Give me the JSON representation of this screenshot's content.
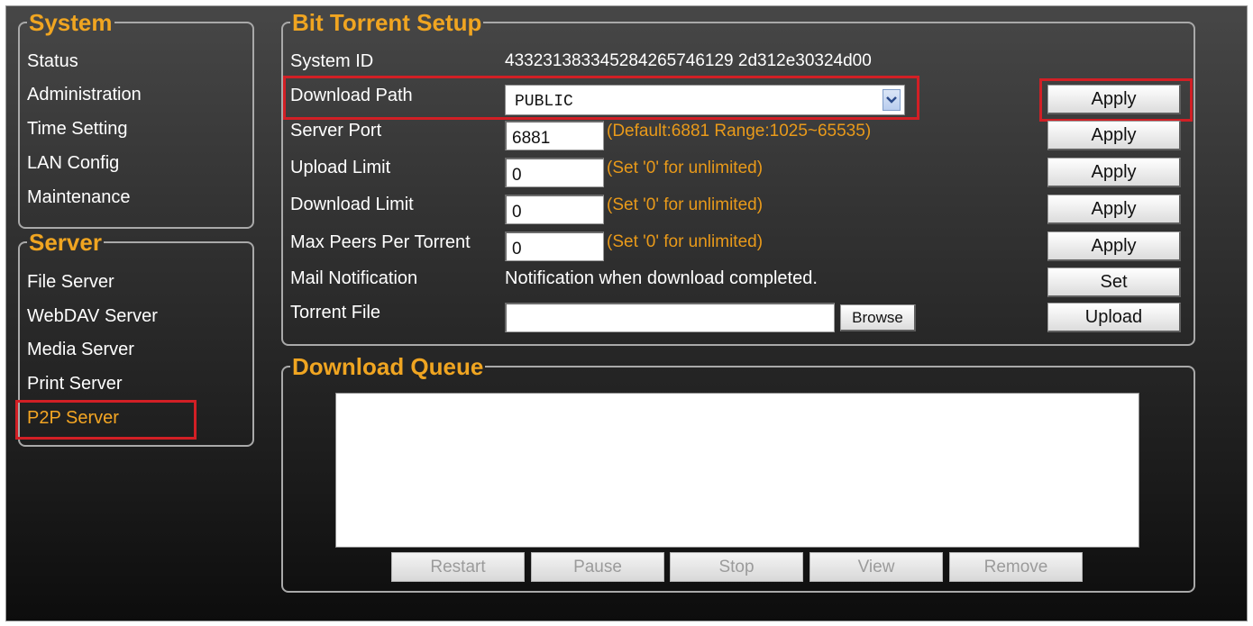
{
  "sidebar": {
    "system_title": "System",
    "system_items": [
      "Status",
      "Administration",
      "Time Setting",
      "LAN Config",
      "Maintenance"
    ],
    "server_title": "Server",
    "server_items": [
      "File Server",
      "WebDAV Server",
      "Media Server",
      "Print Server",
      "P2P Server"
    ],
    "active_item": "P2P Server"
  },
  "setup": {
    "title": "Bit Torrent Setup",
    "system_id_label": "System ID",
    "system_id_value": "433231383345284265746129 2d312e30324d00",
    "download_path_label": "Download Path",
    "download_path_value": "PUBLIC",
    "server_port_label": "Server Port",
    "server_port_value": "6881",
    "server_port_hint": "(Default:6881 Range:1025~65535)",
    "upload_limit_label": "Upload Limit",
    "upload_limit_value": "0",
    "upload_limit_hint": "(Set '0' for unlimited)",
    "download_limit_label": "Download Limit",
    "download_limit_value": "0",
    "download_limit_hint": "(Set '0' for unlimited)",
    "max_peers_label": "Max Peers Per Torrent",
    "max_peers_value": "0",
    "max_peers_hint": "(Set '0' for unlimited)",
    "mail_label": "Mail Notification",
    "mail_text": "Notification when download completed.",
    "torrent_label": "Torrent File",
    "torrent_value": "",
    "browse_label": "Browse",
    "apply_label": "Apply",
    "set_label": "Set",
    "upload_label": "Upload"
  },
  "queue": {
    "title": "Download Queue",
    "buttons": [
      "Restart",
      "Pause",
      "Stop",
      "View",
      "Remove"
    ]
  },
  "colors": {
    "accent": "#f0a521",
    "highlight": "#d21f25",
    "hint": "#e99a1a"
  }
}
